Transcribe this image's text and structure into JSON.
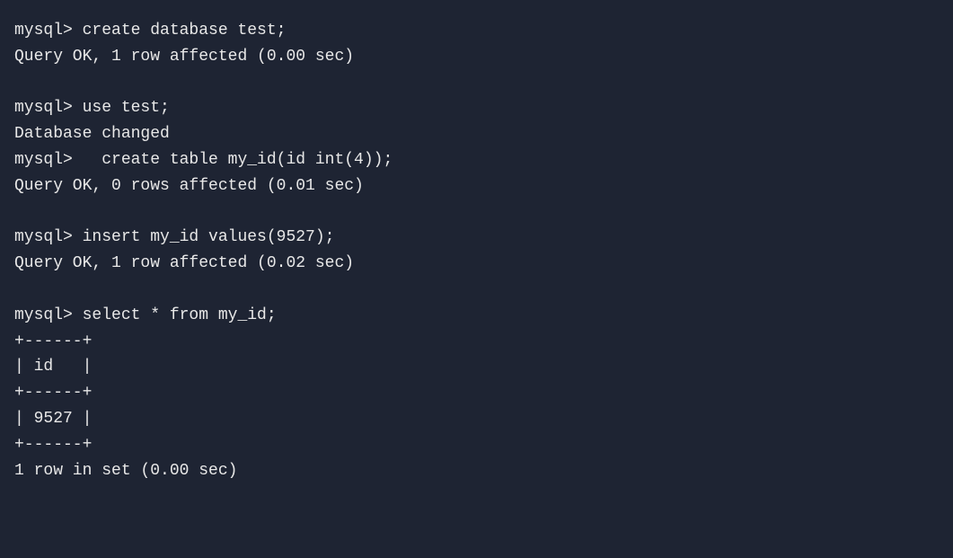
{
  "terminal": {
    "bg_color": "#1e2433",
    "text_color": "#e8e8e8",
    "lines": [
      {
        "type": "prompt",
        "text": "mysql> create database test;"
      },
      {
        "type": "result",
        "text": "Query OK, 1 row affected (0.00 sec)"
      },
      {
        "type": "spacer"
      },
      {
        "type": "prompt",
        "text": "mysql> use test;"
      },
      {
        "type": "result",
        "text": "Database changed"
      },
      {
        "type": "prompt",
        "text": "mysql>   create table my_id(id int(4));"
      },
      {
        "type": "result",
        "text": "Query OK, 0 rows affected (0.01 sec)"
      },
      {
        "type": "spacer"
      },
      {
        "type": "prompt",
        "text": "mysql> insert my_id values(9527);"
      },
      {
        "type": "result",
        "text": "Query OK, 1 row affected (0.02 sec)"
      },
      {
        "type": "spacer"
      },
      {
        "type": "prompt",
        "text": "mysql> select * from my_id;"
      },
      {
        "type": "result",
        "text": "+------+"
      },
      {
        "type": "result",
        "text": "| id   |"
      },
      {
        "type": "result",
        "text": "+------+"
      },
      {
        "type": "result",
        "text": "| 9527 |"
      },
      {
        "type": "result",
        "text": "+------+"
      },
      {
        "type": "result",
        "text": "1 row in set (0.00 sec)"
      }
    ]
  }
}
